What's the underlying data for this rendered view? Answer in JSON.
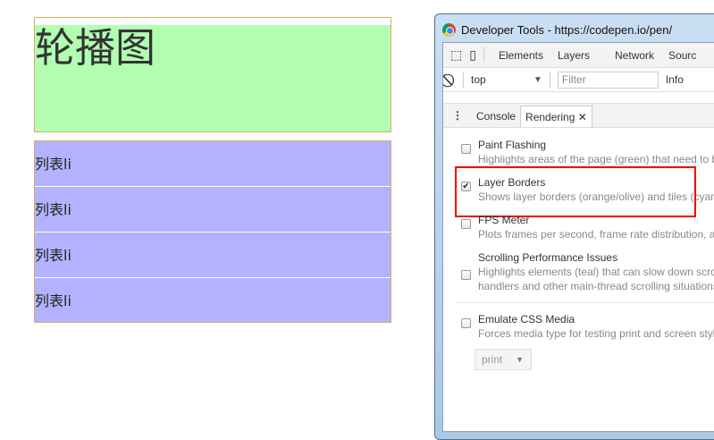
{
  "page": {
    "carousel_title": "轮播图",
    "list_items": [
      "列表li",
      "列表li",
      "列表li",
      "列表li"
    ]
  },
  "devtools": {
    "window_title": "Developer Tools - https://codepen.io/pen/",
    "tabs": [
      "Elements",
      "Layers",
      "Network",
      "Sourc"
    ],
    "context": "top",
    "filter_placeholder": "Filter",
    "level": "Info",
    "drawer_tabs": {
      "console": "Console",
      "rendering": "Rendering"
    },
    "options": [
      {
        "title": "Paint Flashing",
        "desc": "Highlights areas of the page (green) that need to be",
        "checked": false
      },
      {
        "title": "Layer Borders",
        "desc": "Shows layer borders (orange/olive) and tiles (cyan)",
        "checked": true
      },
      {
        "title": "FPS Meter",
        "desc": "Plots frames per second, frame rate distribution, and",
        "checked": false
      },
      {
        "title": "Scrolling Performance Issues",
        "desc": "Highlights elements (teal) that can slow down scroll",
        "desc2": "handlers and other main-thread scrolling situations",
        "checked": false
      },
      {
        "title": "Emulate CSS Media",
        "desc": "Forces media type for testing print and screen style",
        "checked": false
      }
    ],
    "media_select": "print"
  },
  "colors": {
    "carousel_bg": "#b2ffb2",
    "list_bg": "#b2b2ff",
    "layer_border": "#dcae5a",
    "highlight": "#e00000"
  }
}
